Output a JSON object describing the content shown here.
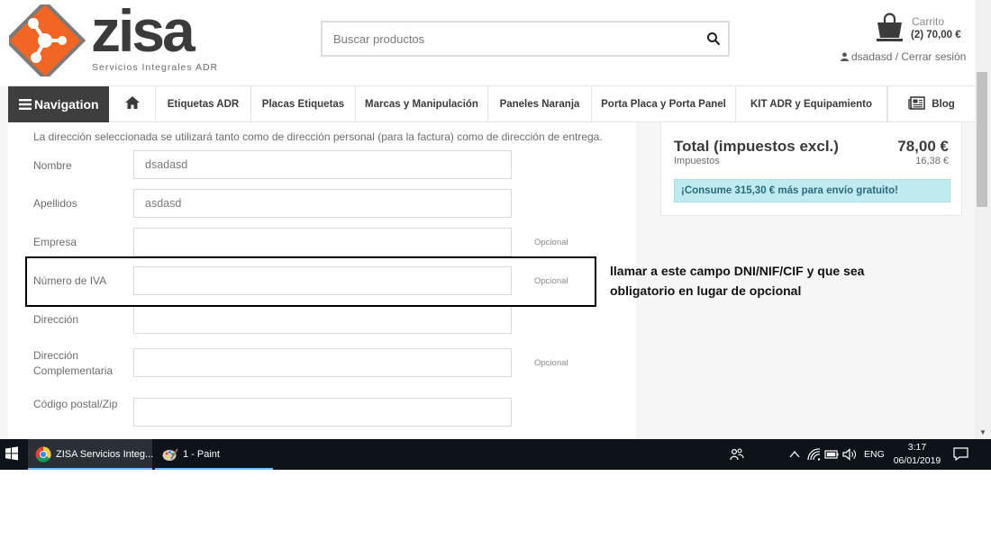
{
  "header": {
    "logo_name": "ZISA",
    "logo_text": "zisa",
    "logo_subtitle": "Servicios Integrales ADR",
    "search_placeholder": "Buscar productos",
    "cart_label": "Carrito",
    "cart_summary": "(2) 70,00 €",
    "user_name": "dsadasd",
    "user_separator": " / ",
    "logout_label": "Cerrar sesión"
  },
  "nav": {
    "toggle_label": "Navigation",
    "items": [
      {
        "label": "Etiquetas ADR"
      },
      {
        "label": "Placas Etiquetas"
      },
      {
        "label": "Marcas y Manipulación"
      },
      {
        "label": "Paneles Naranja"
      },
      {
        "label": "Porta Placa y Porta Panel"
      },
      {
        "label": "KIT ADR y Equipamiento"
      },
      {
        "label": "Blog"
      }
    ]
  },
  "form": {
    "notice": "La dirección seleccionada se utilizará tanto como de dirección personal (para la factura) como de dirección de entrega.",
    "fields": [
      {
        "label": "Nombre",
        "value": "dsadasd",
        "optional": ""
      },
      {
        "label": "Apellidos",
        "value": "asdasd",
        "optional": ""
      },
      {
        "label": "Empresa",
        "value": "",
        "optional": "Opcional"
      },
      {
        "label": "Número de IVA",
        "value": "",
        "optional": "Opcional"
      },
      {
        "label": "Dirección",
        "value": "",
        "optional": ""
      },
      {
        "label": "Dirección Complementaria",
        "value": "",
        "optional": "Opcional"
      },
      {
        "label": "Código postal/Zip",
        "value": "",
        "optional": ""
      }
    ]
  },
  "summary": {
    "total_label": "Total (impuestos excl.)",
    "total_value": "78,00 €",
    "tax_label": "Impuestos",
    "tax_value": "16,38 €",
    "shipping_message": "¡Consume 315,30 € más para envío gratuito!"
  },
  "annotation": {
    "text": "llamar a este campo DNI/NIF/CIF y que sea obligatorio en lugar de opcional"
  },
  "taskbar": {
    "items": [
      {
        "label": "ZISA Servicios Integ..."
      },
      {
        "label": "1 - Paint"
      }
    ],
    "language": "ENG",
    "time": "3:17",
    "date": "06/01/2019"
  },
  "colors": {
    "brand_orange": "#f26522",
    "nav_dark": "#3e3e3e",
    "alert_bg": "#bfebf0",
    "taskbar_bg": "#0e1319"
  }
}
